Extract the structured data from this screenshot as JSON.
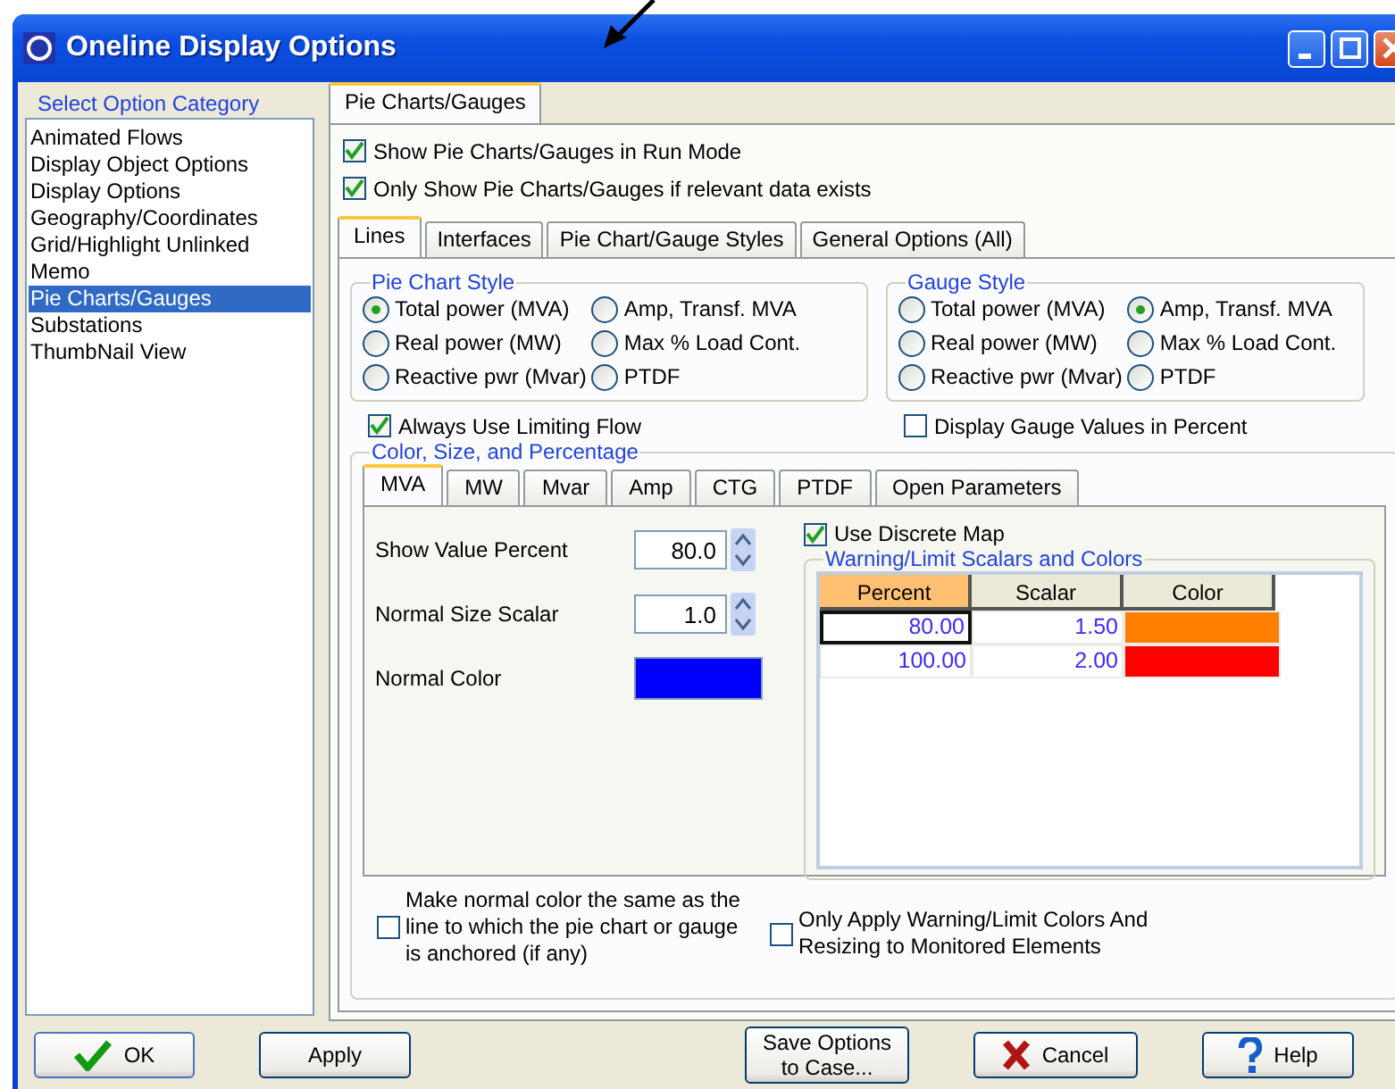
{
  "window": {
    "title": "Oneline Display Options"
  },
  "category_panel": {
    "title": "Select Option Category",
    "items": [
      {
        "label": "Animated Flows",
        "selected": false
      },
      {
        "label": "Display Object Options",
        "selected": false
      },
      {
        "label": "Display Options",
        "selected": false
      },
      {
        "label": "Geography/Coordinates",
        "selected": false
      },
      {
        "label": "Grid/Highlight Unlinked",
        "selected": false
      },
      {
        "label": "Memo",
        "selected": false
      },
      {
        "label": "Pie Charts/Gauges",
        "selected": true
      },
      {
        "label": "Substations",
        "selected": false
      },
      {
        "label": "ThumbNail View",
        "selected": false
      }
    ]
  },
  "main_tabs": [
    {
      "label": "Pie Charts/Gauges",
      "selected": true
    }
  ],
  "top_options": [
    {
      "label": "Show Pie Charts/Gauges in Run Mode",
      "checked": true
    },
    {
      "label": "Only Show Pie Charts/Gauges if relevant data exists",
      "checked": true
    }
  ],
  "sub_tabs": [
    {
      "label": "Lines",
      "selected": true
    },
    {
      "label": "Interfaces",
      "selected": false
    },
    {
      "label": "Pie Chart/Gauge Styles",
      "selected": false
    },
    {
      "label": "General Options (All)",
      "selected": false
    }
  ],
  "style_groups": [
    {
      "title": "Pie Chart Style",
      "options": [
        {
          "label": "Total power (MVA)",
          "selected": true
        },
        {
          "label": "Amp, Transf. MVA",
          "selected": false
        },
        {
          "label": "Real power (MW)",
          "selected": false
        },
        {
          "label": "Max % Load Cont.",
          "selected": false
        },
        {
          "label": "Reactive pwr (Mvar)",
          "selected": false
        },
        {
          "label": "PTDF",
          "selected": false
        }
      ],
      "checkbox": {
        "label": "Always Use Limiting Flow",
        "checked": true
      }
    },
    {
      "title": "Gauge Style",
      "options": [
        {
          "label": "Total power (MVA)",
          "selected": false
        },
        {
          "label": "Amp, Transf. MVA",
          "selected": true
        },
        {
          "label": "Real power (MW)",
          "selected": false
        },
        {
          "label": "Max % Load Cont.",
          "selected": false
        },
        {
          "label": "Reactive pwr (Mvar)",
          "selected": false
        },
        {
          "label": "PTDF",
          "selected": false
        }
      ],
      "checkbox": {
        "label": "Display Gauge Values in Percent",
        "checked": false
      }
    }
  ],
  "color_group": {
    "title": "Color, Size, and Percentage",
    "tabs": [
      {
        "label": "MVA",
        "selected": true
      },
      {
        "label": "MW",
        "selected": false
      },
      {
        "label": "Mvar",
        "selected": false
      },
      {
        "label": "Amp",
        "selected": false
      },
      {
        "label": "CTG",
        "selected": false
      },
      {
        "label": "PTDF",
        "selected": false
      },
      {
        "label": "Open Parameters",
        "selected": false
      }
    ],
    "fields": [
      {
        "label": "Show Value Percent",
        "value": "80.0"
      },
      {
        "label": "Normal Size Scalar",
        "value": "1.0"
      }
    ],
    "normal_color": {
      "label": "Normal Color",
      "color": "#0000ff"
    },
    "discrete_map": {
      "label": "Use Discrete Map",
      "checked": true
    },
    "table": {
      "title": "Warning/Limit Scalars and Colors",
      "columns": [
        {
          "label": "Percent",
          "selected": true
        },
        {
          "label": "Scalar",
          "selected": false
        },
        {
          "label": "Color",
          "selected": false
        }
      ],
      "rows": [
        {
          "percent": "80.00",
          "scalar": "1.50",
          "color": "#ff8000",
          "selected": true
        },
        {
          "percent": "100.00",
          "scalar": "2.00",
          "color": "#ff0000",
          "selected": false
        }
      ]
    }
  },
  "bottom_options": [
    {
      "label": "Make normal color the same as the line to which the pie chart or gauge is anchored (if any)",
      "checked": false
    },
    {
      "label": "Only Apply Warning/Limit Colors And Resizing to Monitored Elements",
      "checked": false
    }
  ],
  "buttons": [
    {
      "label": "OK",
      "kind": "ok"
    },
    {
      "label": "Apply",
      "kind": "plain"
    },
    {
      "label": "Save Options to Case...",
      "kind": "plain"
    },
    {
      "label": "Cancel",
      "kind": "cancel"
    },
    {
      "label": "Help",
      "kind": "help"
    }
  ]
}
